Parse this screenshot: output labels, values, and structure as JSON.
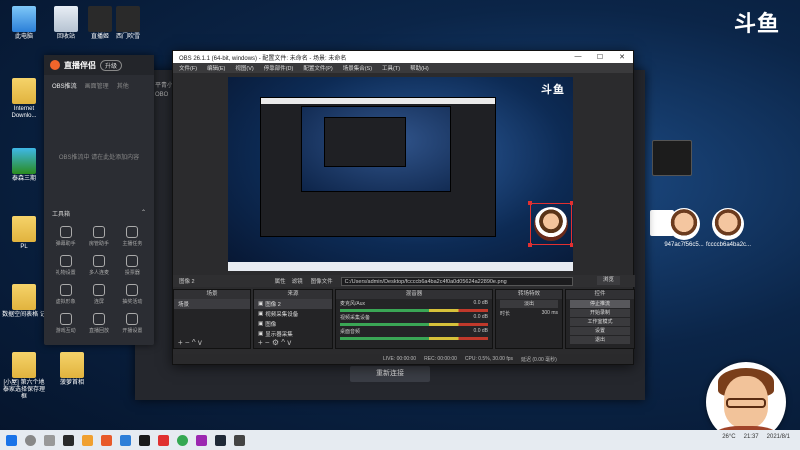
{
  "desktop": {
    "icons_left": [
      {
        "label": "此电脑",
        "kind": "pc"
      },
      {
        "label": "Internet Downlo...",
        "kind": "folder"
      },
      {
        "label": "泰森三期",
        "kind": "folder"
      },
      {
        "label": "PL",
        "kind": "folder"
      },
      {
        "label": "数据空间表格\n记",
        "kind": "folder"
      },
      {
        "label": "[小屋] 第六个地\n泰家选择保存理框",
        "kind": "folder"
      }
    ],
    "icons_top": [
      {
        "label": "回收站",
        "kind": "bin"
      },
      {
        "label": "直播姬",
        "kind": "app"
      },
      {
        "label": "西门吹雪",
        "kind": "app"
      }
    ],
    "icons_right": [
      {
        "label": "",
        "kind": "dark"
      },
      {
        "label": "",
        "kind": "doc"
      },
      {
        "label": "947ac7f56c5...",
        "kind": "avatar"
      },
      {
        "label": "fccccb6a4ba2c...",
        "kind": "avatar"
      }
    ],
    "icon_bottom": {
      "label": "菠萝首相",
      "kind": "folder"
    }
  },
  "douyu_logo": "斗鱼",
  "tool_panel": {
    "brand": "直播伴侣",
    "badge": "升级",
    "tabs": [
      "OBS推流",
      "画面管理",
      "其他"
    ],
    "empty_tip": "OBS推流中 请在此处添加内容",
    "tools_title": "工具箱",
    "tools": [
      "弹幕助手",
      "房管助手",
      "主播任务",
      "礼物设置",
      "多人连麦",
      "投票器",
      "虚拟形象",
      "连屏",
      "抽奖活动",
      "游戏互动",
      "直播回放",
      "开播设置"
    ]
  },
  "back_window": {
    "tabs": "平青小",
    "extra": "OBO",
    "bottom_button": "重新连接"
  },
  "obs": {
    "title": "OBS 26.1.1 (64-bit, windows) - 配置文件: 未命名 - 场景: 未命名",
    "window_buttons": [
      "—",
      "☐",
      "✕"
    ],
    "menu": [
      "文件(F)",
      "编辑(E)",
      "视图(V)",
      "停靠部件(D)",
      "配置文件(P)",
      "场景集合(S)",
      "工具(T)",
      "帮助(H)"
    ],
    "scene_label": "图像 2",
    "toolbar": {
      "properties": "属性",
      "filters": "滤镜",
      "image_file_label": "图像文件",
      "path": "C:/Users/admin/Desktop/fccccb6a4ba2c4f0a0d05624a22890e.png",
      "browse": "浏览"
    },
    "docks": {
      "scenes": {
        "title": "场景",
        "items": [
          "场景"
        ]
      },
      "sources": {
        "title": "来源",
        "items": [
          "图像 2",
          "视频采集设备",
          "图像",
          "显示器采集"
        ]
      },
      "mixer": {
        "title": "混音器",
        "channels": [
          {
            "name": "麦克风/Aux",
            "db": "0.0 dB"
          },
          {
            "name": "视频采集设备",
            "db": "0.0 dB"
          },
          {
            "name": "桌面音频",
            "db": "0.0 dB"
          }
        ]
      },
      "transitions": {
        "title": "转场特效",
        "type": "淡出",
        "duration_label": "时长",
        "duration": "300 ms"
      },
      "controls": {
        "title": "控件",
        "buttons": [
          "停止推流",
          "开始录制",
          "工作室模式",
          "设置",
          "退出"
        ]
      }
    },
    "status": {
      "live": "LIVE: 00:00:00",
      "rec": "REC: 00:00:00",
      "cpu": "CPU: 0.5%, 30.00 fps",
      "dropped": "延迟 (0.00 毫秒)"
    }
  },
  "taskbar": {
    "weather": "26°C",
    "time": "21:37",
    "date": "2021/8/1"
  },
  "colors": {
    "obs_bg": "#2b2b2d",
    "selection": "#e23030",
    "accent_orange": "#f0652b"
  }
}
